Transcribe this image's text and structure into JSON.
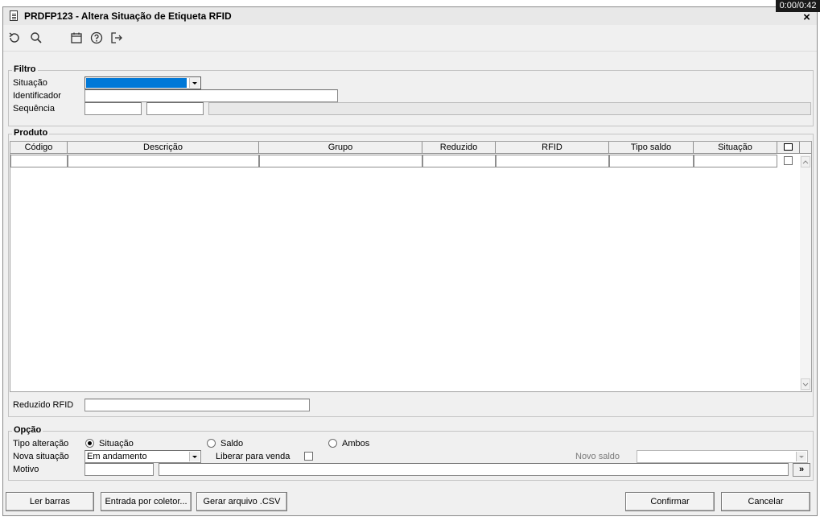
{
  "window": {
    "title": "PRDFP123 - Altera Situação de Etiqueta RFID",
    "timer": "0:00/0:42",
    "close_glyph": "×"
  },
  "toolbar": {
    "icons": [
      "refresh-icon",
      "search-icon",
      "calendar-icon",
      "help-icon",
      "exit-icon"
    ]
  },
  "filtro": {
    "title": "Filtro",
    "situacao_label": "Situação",
    "situacao_value": "",
    "identificador_label": "Identificador",
    "identificador_value": "",
    "sequencia_label": "Sequência",
    "sequencia_from": "",
    "sequencia_to": "",
    "sequencia_desc": ""
  },
  "produto": {
    "title": "Produto",
    "columns": [
      "Código",
      "Descrição",
      "Grupo",
      "Reduzido",
      "RFID",
      "Tipo saldo",
      "Situação"
    ],
    "rows": [
      [
        "",
        "",
        "",
        "",
        "",
        "",
        ""
      ]
    ],
    "reduzido_rfid_label": "Reduzido RFID",
    "reduzido_rfid_value": ""
  },
  "opcao": {
    "title": "Opção",
    "tipo_alteracao_label": "Tipo alteração",
    "radio_situacao": "Situação",
    "radio_saldo": "Saldo",
    "radio_ambos": "Ambos",
    "selected": "Situação",
    "nova_situacao_label": "Nova situação",
    "nova_situacao_value": "Em andamento",
    "liberar_label": "Liberar para venda",
    "liberar_checked": false,
    "novo_saldo_label": "Novo saldo",
    "novo_saldo_value": "",
    "motivo_label": "Motivo",
    "motivo_code": "",
    "motivo_desc": "",
    "motivo_lookup": "»"
  },
  "buttons": {
    "ler_barras": "Ler barras",
    "entrada_coletor": "Entrada por coletor...",
    "gerar_csv": "Gerar arquivo .CSV",
    "confirmar": "Confirmar",
    "cancelar": "Cancelar"
  },
  "colors": {
    "selection": "#0078d7",
    "window_bg": "#f0f0f0"
  }
}
